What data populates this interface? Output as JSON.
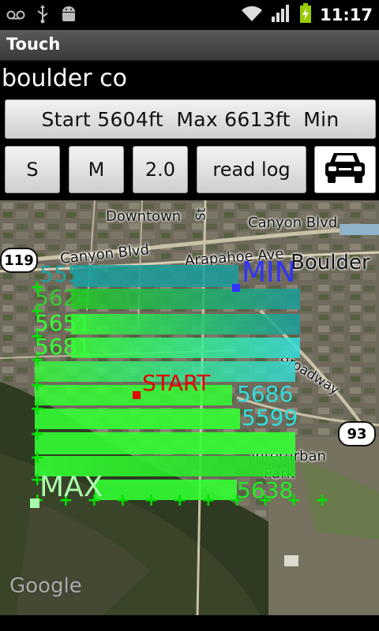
{
  "status_bar": {
    "time": "11:17",
    "icons_left": [
      "voicemail-icon",
      "usb-icon",
      "android-debug-icon"
    ],
    "icons_right": [
      "wifi-icon",
      "signal-icon",
      "battery-charging-icon"
    ]
  },
  "titlebar": {
    "title": "Touch"
  },
  "location": {
    "text": "boulder co"
  },
  "stats_button": {
    "label": "Start 5604ft  Max 6613ft  Min"
  },
  "controls": {
    "s_label": "S",
    "m_label": "M",
    "zoom_label": "2.0",
    "read_log_label": "read log",
    "car_icon": "car-icon"
  },
  "map": {
    "labels": {
      "downtown": "Downtown",
      "canyon_blvd_right": "Canyon Blvd",
      "canyon_blvd_left": "Canyon Blvd",
      "arapahoe": "Arapahoe Ave",
      "boulder": "Boulder",
      "broadway": "Broadway",
      "interurban": "Interurban",
      "park": "Park",
      "st": "St",
      "google": "Google"
    },
    "shields": {
      "left": "119",
      "right": "93"
    },
    "markers": {
      "min": "MIN",
      "max": "MAX",
      "start": "START"
    },
    "elevation_readouts": [
      "5599",
      "5686",
      "5638",
      "5624",
      "5651",
      "5681",
      "5553"
    ],
    "colors": {
      "min_marker": "#3333ff",
      "start_marker": "#e00000",
      "max_marker": "#aaffaa",
      "teal": "#1aa3a3",
      "cyan": "#33dddd",
      "green": "#00ff00"
    }
  }
}
